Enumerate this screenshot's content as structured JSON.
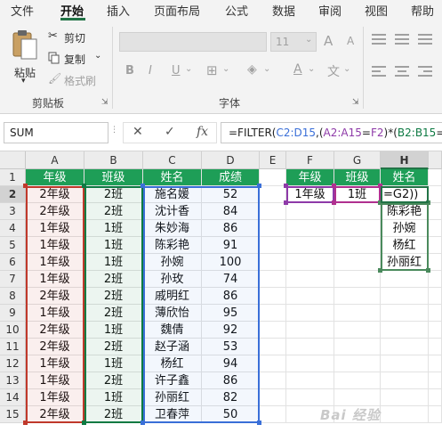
{
  "ribbon_tabs": [
    "文件",
    "开始",
    "插入",
    "页面布局",
    "公式",
    "数据",
    "审阅",
    "视图",
    "帮助"
  ],
  "active_tab": "开始",
  "clipboard": {
    "paste_label": "粘贴",
    "cut_label": "剪切",
    "copy_label": "复制",
    "format_painter_label": "格式刷",
    "group_label": "剪贴板"
  },
  "font_group": {
    "font_size": "11",
    "bold": "B",
    "italic": "I",
    "underline": "U",
    "grow_font": "A",
    "shrink_font": "A",
    "group_label": "字体"
  },
  "formula_bar": {
    "name_box": "SUM",
    "fx_label": "fx",
    "formula_parts": [
      {
        "text": "=FILTER(",
        "color": "#222222"
      },
      {
        "text": "C2:D15",
        "color": "#3a6fd8"
      },
      {
        "text": ",(",
        "color": "#222222"
      },
      {
        "text": "A2:A15",
        "color": "#8e3aa8"
      },
      {
        "text": "=",
        "color": "#222222"
      },
      {
        "text": "F2",
        "color": "#8e3aa8"
      },
      {
        "text": ")*(",
        "color": "#222222"
      },
      {
        "text": "B2:B15",
        "color": "#0e7a43"
      },
      {
        "text": "=G",
        "color": "#222222"
      }
    ]
  },
  "grid": {
    "columns": [
      "A",
      "B",
      "C",
      "D",
      "E",
      "F",
      "G",
      "H"
    ],
    "selected_column": "H",
    "selected_row": "2",
    "rows": [
      {
        "num": "1",
        "cells": [
          "年级",
          "班级",
          "姓名",
          "成绩",
          "",
          "年级",
          "班级",
          "姓名"
        ]
      },
      {
        "num": "2",
        "cells": [
          "2年级",
          "2班",
          "施名媛",
          "52",
          "",
          "1年级",
          "1班",
          "=G2))"
        ]
      },
      {
        "num": "3",
        "cells": [
          "2年级",
          "2班",
          "沈计香",
          "84",
          "",
          "",
          "",
          "陈彩艳"
        ]
      },
      {
        "num": "4",
        "cells": [
          "1年级",
          "1班",
          "朱妙海",
          "86",
          "",
          "",
          "",
          "孙婉"
        ]
      },
      {
        "num": "5",
        "cells": [
          "1年级",
          "1班",
          "陈彩艳",
          "91",
          "",
          "",
          "",
          "杨红"
        ]
      },
      {
        "num": "6",
        "cells": [
          "1年级",
          "1班",
          "孙婉",
          "100",
          "",
          "",
          "",
          "孙丽红"
        ]
      },
      {
        "num": "7",
        "cells": [
          "1年级",
          "2班",
          "孙玫",
          "74",
          "",
          "",
          "",
          ""
        ]
      },
      {
        "num": "8",
        "cells": [
          "2年级",
          "2班",
          "戚明红",
          "86",
          "",
          "",
          "",
          ""
        ]
      },
      {
        "num": "9",
        "cells": [
          "1年级",
          "2班",
          "薄欣怡",
          "95",
          "",
          "",
          "",
          ""
        ]
      },
      {
        "num": "10",
        "cells": [
          "2年级",
          "1班",
          "魏倩",
          "92",
          "",
          "",
          "",
          ""
        ]
      },
      {
        "num": "11",
        "cells": [
          "2年级",
          "2班",
          "赵子涵",
          "53",
          "",
          "",
          "",
          ""
        ]
      },
      {
        "num": "12",
        "cells": [
          "1年级",
          "1班",
          "杨红",
          "94",
          "",
          "",
          "",
          ""
        ]
      },
      {
        "num": "13",
        "cells": [
          "1年级",
          "2班",
          "许子鑫",
          "86",
          "",
          "",
          "",
          ""
        ]
      },
      {
        "num": "14",
        "cells": [
          "1年级",
          "1班",
          "孙丽红",
          "82",
          "",
          "",
          "",
          ""
        ]
      },
      {
        "num": "15",
        "cells": [
          "2年级",
          "2班",
          "卫春萍",
          "50",
          "",
          "",
          "",
          ""
        ]
      }
    ]
  },
  "colors": {
    "header_green": "#1e9e57",
    "range_purple": "#8e3aa8",
    "range_green": "#0e7a43",
    "range_blue": "#3a6fd8",
    "range_red": "#c0392b",
    "range_magenta": "#b0308f"
  },
  "watermark": "Bai 经验"
}
